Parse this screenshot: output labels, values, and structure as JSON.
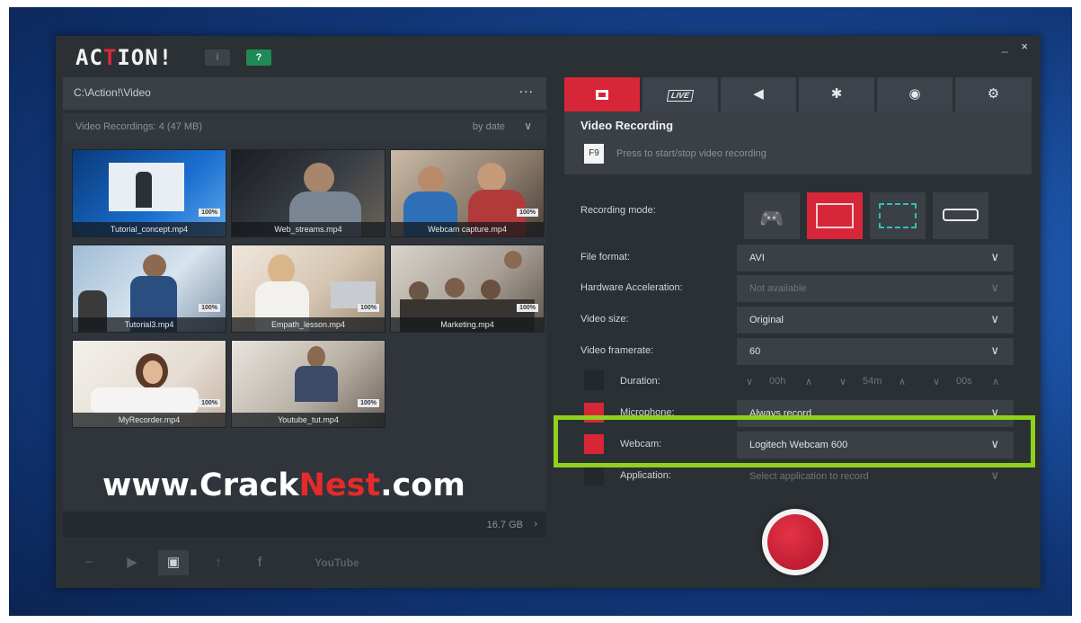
{
  "app": {
    "logo": "ACTION!",
    "info_label": "i",
    "help_label": "?",
    "minimize": "_",
    "close": "×"
  },
  "left": {
    "path": "C:\\Action!\\Video",
    "path_more": "...",
    "recordings_count": "Video Recordings: 4 (47 MB)",
    "sort": "by date",
    "videos": [
      {
        "name": "Tutorial_concept.mp4",
        "badge": "100%"
      },
      {
        "name": "Web_streams.mp4",
        "badge": ""
      },
      {
        "name": "Webcam capture.mp4",
        "badge": "100%"
      },
      {
        "name": "Tutorial3.mp4",
        "badge": "100%"
      },
      {
        "name": "Empath_lesson.mp4",
        "badge": "100%"
      },
      {
        "name": "Marketing.mp4",
        "badge": "100%"
      },
      {
        "name": "MyRecorder.mp4",
        "badge": "100%"
      },
      {
        "name": "Youtube_tut.mp4",
        "badge": "100%"
      }
    ],
    "watermark_a": "www.Crack",
    "watermark_b": "Nest",
    "watermark_c": ".com",
    "storage": "16.7 GB",
    "bottom_youtube": "YouTube"
  },
  "right": {
    "tabs": [
      "record",
      "LIVE",
      "audio",
      "bug",
      "screenshot",
      "settings"
    ],
    "section_title": "Video Recording",
    "hotkey": "F9",
    "hotkey_hint": "Press to start/stop video recording",
    "labels": {
      "mode": "Recording mode:",
      "format": "File format:",
      "hw": "Hardware Acceleration:",
      "size": "Video size:",
      "fps": "Video framerate:",
      "duration": "Duration:",
      "mic": "Microphone:",
      "webcam": "Webcam:",
      "app": "Application:"
    },
    "values": {
      "format": "AVI",
      "hw": "Not available",
      "size": "Original",
      "fps": "60",
      "dur_h": "00h",
      "dur_m": "54m",
      "dur_s": "00s",
      "mic": "Always record",
      "webcam": "Logitech Webcam 600",
      "app": "Select application to record"
    }
  },
  "colors": {
    "accent": "#d72638",
    "highlight": "#8fd11e",
    "panel": "#2b3035"
  }
}
